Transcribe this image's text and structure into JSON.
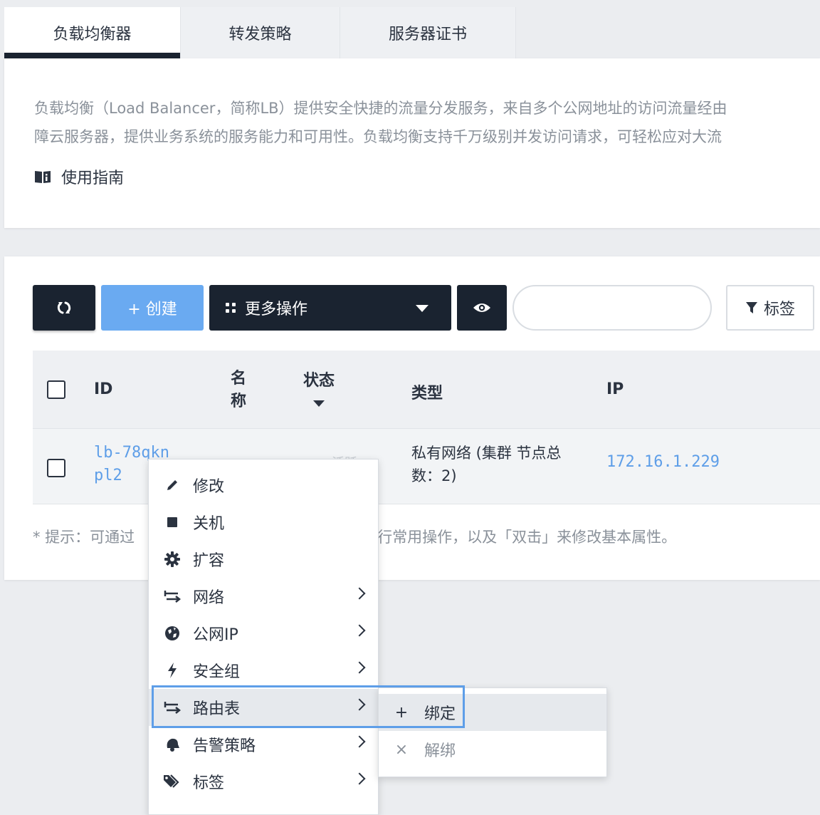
{
  "tabs": [
    {
      "label": "负载均衡器",
      "active": true
    },
    {
      "label": "转发策略",
      "active": false
    },
    {
      "label": "服务器证书",
      "active": false
    }
  ],
  "intro": {
    "line1": "负载均衡（Load Balancer，简称LB）提供安全快捷的流量分发服务，来自多个公网地址的访问流量经由",
    "line2": "障云服务器，提供业务系统的服务能力和可用性。负载均衡支持千万级别并发访问请求，可轻松应对大流",
    "guide_label": "使用指南"
  },
  "toolbar": {
    "create_label": "+ 创建",
    "more_label": "更多操作",
    "search_placeholder": "",
    "tags_label": "标签"
  },
  "table": {
    "headers": {
      "id": "ID",
      "name_1": "名",
      "name_2": "称",
      "status": "状态",
      "type": "类型",
      "ip": "IP"
    },
    "row": {
      "id_1": "lb-78qkn",
      "id_2": "pl2",
      "status": "活跃",
      "type": "私有网络 (集群 节点总数：2)",
      "ip": "172.16.1.229"
    }
  },
  "hint": {
    "prefix": "* 提示：可通过",
    "suffix": "进行常用操作，以及「双击」来修改基本属性。"
  },
  "context_menu": {
    "items": [
      {
        "label": "修改",
        "icon": "pencil-icon",
        "submenu": false
      },
      {
        "label": "关机",
        "icon": "stop-icon",
        "submenu": false
      },
      {
        "label": "扩容",
        "icon": "gear-icon",
        "submenu": false
      },
      {
        "label": "网络",
        "icon": "swap-icon",
        "submenu": true
      },
      {
        "label": "公网IP",
        "icon": "globe-icon",
        "submenu": true
      },
      {
        "label": "安全组",
        "icon": "bolt-icon",
        "submenu": true
      },
      {
        "label": "路由表",
        "icon": "swap-icon",
        "submenu": true,
        "hover": true
      },
      {
        "label": "告警策略",
        "icon": "bell-icon",
        "submenu": true
      },
      {
        "label": "标签",
        "icon": "tag-icon",
        "submenu": true
      }
    ],
    "submenu": {
      "bind_icon": "+",
      "bind_label": "绑定",
      "unbind_icon": "×",
      "unbind_label": "解绑"
    }
  },
  "colors": {
    "dark": "#1a2330",
    "primary": "#6aaaf1",
    "link": "#5e9ee8",
    "highlight": "#5e9ee8"
  }
}
